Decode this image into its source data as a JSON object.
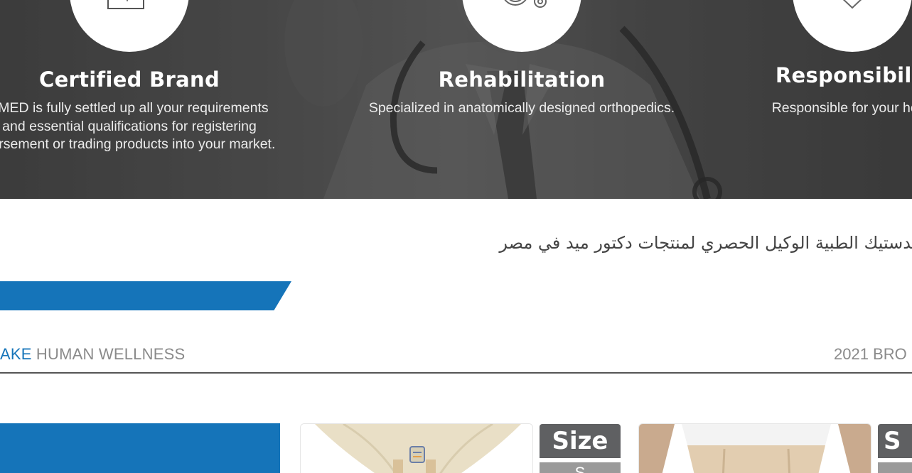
{
  "features": [
    {
      "title": "Certified Brand",
      "lines": [
        "r.MED is fully settled up all your requirements",
        "and essential qualifications for registering",
        "bursement or trading products into your market."
      ],
      "icon": "certificate-icon"
    },
    {
      "title": "Rehabilitation",
      "lines": [
        "Specialized in anatomically designed orthopedics."
      ],
      "icon": "wheelchair-icon"
    },
    {
      "title": "Responsibilit",
      "lines": [
        "Responsible for your healt"
      ],
      "icon": "heartbeat-icon"
    }
  ],
  "arabic_line": "ميدستيك الطبية الوكيل الحصري لمنتجات دكتور ميد في مصر",
  "tagline": {
    "highlight": "AKE",
    "rest": " HUMAN WELLNESS"
  },
  "brochure": "2021 BRO",
  "products": [
    {
      "size_label": "Size",
      "size_sub": "S"
    },
    {
      "size_label": "S",
      "size_sub": ""
    }
  ],
  "colors": {
    "brand_blue": "#1574b9",
    "gray_tag": "#5f6062"
  }
}
